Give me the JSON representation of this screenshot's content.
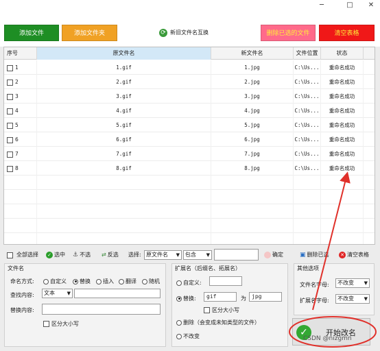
{
  "window": {
    "minimize": "─",
    "maximize": "□",
    "close": "✕"
  },
  "top_buttons": {
    "add_file": "添加文件",
    "add_folder": "添加文件夹",
    "swap_names": "新旧文件名互换",
    "delete_selected": "删除已选的文件",
    "clear_table": "清空表格"
  },
  "colors": {
    "add_file": "#1e8e24",
    "add_folder": "#f0a124",
    "delete_selected": "#ff6a8a",
    "clear_table": "#f01818",
    "annotation": "#e0302a"
  },
  "table": {
    "columns": [
      "序号",
      "原文件名",
      "新文件名",
      "文件位置",
      "状态"
    ],
    "rows": [
      {
        "index": "1",
        "original": "1.gif",
        "new": "1.jpg",
        "location": "C:\\Us...",
        "status": "重命名成功"
      },
      {
        "index": "2",
        "original": "2.gif",
        "new": "2.jpg",
        "location": "C:\\Us...",
        "status": "重命名成功"
      },
      {
        "index": "3",
        "original": "3.gif",
        "new": "3.jpg",
        "location": "C:\\Us...",
        "status": "重命名成功"
      },
      {
        "index": "4",
        "original": "4.gif",
        "new": "4.jpg",
        "location": "C:\\Us...",
        "status": "重命名成功"
      },
      {
        "index": "5",
        "original": "5.gif",
        "new": "5.jpg",
        "location": "C:\\Us...",
        "status": "重命名成功"
      },
      {
        "index": "6",
        "original": "6.gif",
        "new": "6.jpg",
        "location": "C:\\Us...",
        "status": "重命名成功"
      },
      {
        "index": "7",
        "original": "7.gif",
        "new": "7.jpg",
        "location": "C:\\Us...",
        "status": "重命名成功"
      },
      {
        "index": "8",
        "original": "8.gif",
        "new": "8.jpg",
        "location": "C:\\Us...",
        "status": "重命名成功"
      }
    ]
  },
  "toolbar": {
    "select_all": "全部选择",
    "select": "选中",
    "deselect": "不选",
    "invert": "反选",
    "choose_label": "选择:",
    "field_value": "原文件名",
    "match_value": "包含",
    "confirm": "确定",
    "delete_selected": "删除已选",
    "clear_table": "清空表格"
  },
  "filename_group": {
    "title": "文件名",
    "mode_label": "命名方式:",
    "modes": [
      "自定义",
      "替换",
      "插入",
      "翻译",
      "随机"
    ],
    "mode_selected": "替换",
    "find_label": "查找内容:",
    "find_type": "文本",
    "replace_label": "替换内容:",
    "case_label": "区分大小写"
  },
  "ext_group": {
    "title": "扩展名（后缀名、拓展名）",
    "custom_label": "自定义:",
    "replace_label": "替换:",
    "from_value": "gif",
    "to_label": "为",
    "to_value": "jpg",
    "case_label": "区分大小写",
    "delete_label": "删除（会变成未知类型的文件）",
    "unchanged_label": "不改变"
  },
  "other_group": {
    "title": "其他选项",
    "name_case_label": "文件名字母:",
    "name_case_value": "不改变",
    "ext_case_label": "扩展名字母:",
    "ext_case_value": "不改变"
  },
  "start_button": {
    "label": "开始改名"
  },
  "watermark": "CSDN @nizgmn"
}
